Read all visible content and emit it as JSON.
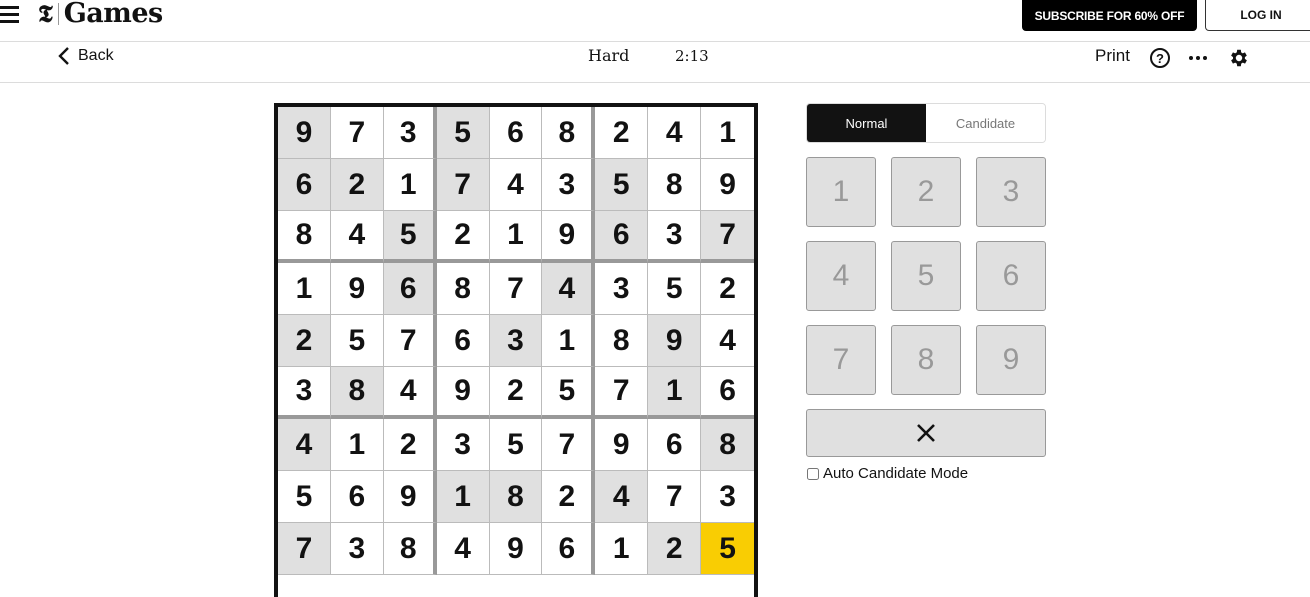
{
  "header": {
    "logo_mark": "𝕿",
    "logo_text": "Games",
    "subscribe_label": "SUBSCRIBE FOR 60% OFF",
    "login_label": "LOG IN"
  },
  "subheader": {
    "back_label": "Back",
    "difficulty": "Hard",
    "timer": "2:13",
    "print_label": "Print",
    "help_label": "?"
  },
  "board": {
    "rows": [
      [
        "9",
        "7",
        "3",
        "5",
        "6",
        "8",
        "2",
        "4",
        "1"
      ],
      [
        "6",
        "2",
        "1",
        "7",
        "4",
        "3",
        "5",
        "8",
        "9"
      ],
      [
        "8",
        "4",
        "5",
        "2",
        "1",
        "9",
        "6",
        "3",
        "7"
      ],
      [
        "1",
        "9",
        "6",
        "8",
        "7",
        "4",
        "3",
        "5",
        "2"
      ],
      [
        "2",
        "5",
        "7",
        "6",
        "3",
        "1",
        "8",
        "9",
        "4"
      ],
      [
        "3",
        "8",
        "4",
        "9",
        "2",
        "5",
        "7",
        "1",
        "6"
      ],
      [
        "4",
        "1",
        "2",
        "3",
        "5",
        "7",
        "9",
        "6",
        "8"
      ],
      [
        "5",
        "6",
        "9",
        "1",
        "8",
        "2",
        "4",
        "7",
        "3"
      ],
      [
        "7",
        "3",
        "8",
        "4",
        "9",
        "6",
        "1",
        "2",
        "5"
      ]
    ],
    "shaded": [
      [
        0,
        0
      ],
      [
        0,
        3
      ],
      [
        1,
        0
      ],
      [
        1,
        1
      ],
      [
        1,
        3
      ],
      [
        1,
        6
      ],
      [
        2,
        2
      ],
      [
        2,
        6
      ],
      [
        2,
        8
      ],
      [
        3,
        2
      ],
      [
        3,
        5
      ],
      [
        4,
        0
      ],
      [
        4,
        4
      ],
      [
        4,
        7
      ],
      [
        5,
        1
      ],
      [
        5,
        7
      ],
      [
        6,
        0
      ],
      [
        6,
        8
      ],
      [
        7,
        3
      ],
      [
        7,
        4
      ],
      [
        7,
        6
      ],
      [
        8,
        0
      ],
      [
        8,
        7
      ]
    ],
    "selected": [
      8,
      8
    ],
    "colors": {
      "shaded": "#e0e0e0",
      "selected": "#f9cd03"
    }
  },
  "panel": {
    "modes": [
      {
        "label": "Normal",
        "active": true
      },
      {
        "label": "Candidate",
        "active": false
      }
    ],
    "numbers": [
      "1",
      "2",
      "3",
      "4",
      "5",
      "6",
      "7",
      "8",
      "9"
    ],
    "erase_icon": "✕",
    "auto_candidate_label": "Auto Candidate Mode",
    "auto_candidate_checked": false
  }
}
